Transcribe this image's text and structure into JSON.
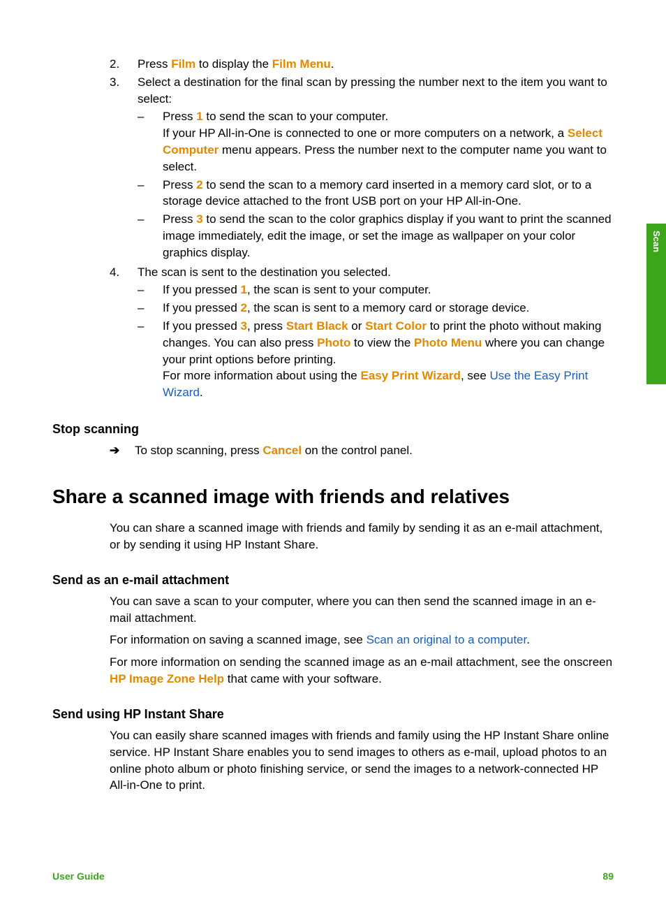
{
  "sideTab": "Scan",
  "steps": {
    "s2": {
      "num": "2.",
      "pre": "Press ",
      "h1": "Film",
      "mid": " to display the ",
      "h2": "Film Menu",
      "post": "."
    },
    "s3": {
      "num": "3.",
      "text": "Select a destination for the final scan by pressing the number next to the item you want to select:"
    },
    "s3a": {
      "line1_pre": "Press ",
      "line1_h": "1",
      "line1_post": " to send the scan to your computer.",
      "line2_pre": "If your HP All-in-One is connected to one or more computers on a network, a ",
      "line2_h": "Select Computer",
      "line2_post": " menu appears. Press the number next to the computer name you want to select."
    },
    "s3b": {
      "pre": "Press ",
      "h": "2",
      "post": " to send the scan to a memory card inserted in a memory card slot, or to a storage device attached to the front USB port on your HP All-in-One."
    },
    "s3c": {
      "pre": "Press ",
      "h": "3",
      "post": " to send the scan to the color graphics display if you want to print the scanned image immediately, edit the image, or set the image as wallpaper on your color graphics display."
    },
    "s4": {
      "num": "4.",
      "text": "The scan is sent to the destination you selected."
    },
    "s4a": {
      "pre": "If you pressed ",
      "h": "1",
      "post": ", the scan is sent to your computer."
    },
    "s4b": {
      "pre": "If you pressed ",
      "h": "2",
      "post": ", the scan is sent to a memory card or storage device."
    },
    "s4c": {
      "p1": "If you pressed ",
      "h1": "3",
      "p2": ", press ",
      "h2": "Start Black",
      "p3": " or ",
      "h3": "Start Color",
      "p4": " to print the photo without making changes. You can also press ",
      "h4": "Photo",
      "p5": " to view the ",
      "h5": "Photo Menu",
      "p6": " where you can change your print options before printing.",
      "p7": "For more information about using the ",
      "h6": "Easy Print Wizard",
      "p8": ", see ",
      "link": "Use the Easy Print Wizard",
      "p9": "."
    }
  },
  "stopScanning": {
    "heading": "Stop scanning",
    "pre": "To stop scanning, press ",
    "h": "Cancel",
    "post": " on the control panel."
  },
  "mainHeading": "Share a scanned image with friends and relatives",
  "sharePara": "You can share a scanned image with friends and family by sending it as an e-mail attachment, or by sending it using HP Instant Share.",
  "emailSection": {
    "heading": "Send as an e-mail attachment",
    "p1": "You can save a scan to your computer, where you can then send the scanned image in an e-mail attachment.",
    "p2_pre": "For information on saving a scanned image, see ",
    "p2_link": "Scan an original to a computer",
    "p2_post": ".",
    "p3_pre": "For more information on sending the scanned image as an e-mail attachment, see the onscreen ",
    "p3_h": "HP Image Zone Help",
    "p3_post": " that came with your software."
  },
  "instantShare": {
    "heading": "Send using HP Instant Share",
    "p1": "You can easily share scanned images with friends and family using the HP Instant Share online service. HP Instant Share enables you to send images to others as e-mail, upload photos to an online photo album or photo finishing service, or send the images to a network-connected HP All-in-One to print."
  },
  "footer": {
    "left": "User Guide",
    "right": "89"
  },
  "dash": "–",
  "arrow": "➔"
}
